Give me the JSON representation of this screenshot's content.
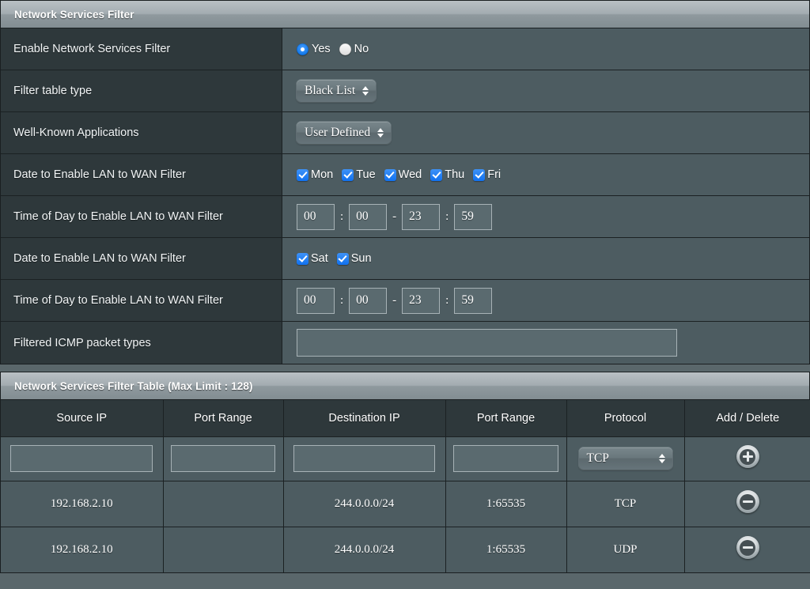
{
  "filter_panel": {
    "title": "Network Services Filter",
    "rows": {
      "enable": {
        "label": "Enable Network Services Filter",
        "options": [
          {
            "label": "Yes",
            "checked": true
          },
          {
            "label": "No",
            "checked": false
          }
        ]
      },
      "filter_table_type": {
        "label": "Filter table type",
        "value": "Black List"
      },
      "well_known_apps": {
        "label": "Well-Known Applications",
        "value": "User Defined"
      },
      "date_weekday": {
        "label": "Date to Enable LAN to WAN Filter",
        "days": [
          {
            "label": "Mon",
            "checked": true
          },
          {
            "label": "Tue",
            "checked": true
          },
          {
            "label": "Wed",
            "checked": true
          },
          {
            "label": "Thu",
            "checked": true
          },
          {
            "label": "Fri",
            "checked": true
          }
        ]
      },
      "time_weekday": {
        "label": "Time of Day to Enable LAN to WAN Filter",
        "start_hour": "00",
        "start_min": "00",
        "end_hour": "23",
        "end_min": "59",
        "colon": ":",
        "dash": "-"
      },
      "date_weekend": {
        "label": "Date to Enable LAN to WAN Filter",
        "days": [
          {
            "label": "Sat",
            "checked": true
          },
          {
            "label": "Sun",
            "checked": true
          }
        ]
      },
      "time_weekend": {
        "label": "Time of Day to Enable LAN to WAN Filter",
        "start_hour": "00",
        "start_min": "00",
        "end_hour": "23",
        "end_min": "59",
        "colon": ":",
        "dash": "-"
      },
      "icmp": {
        "label": "Filtered ICMP packet types",
        "value": "",
        "placeholder": ""
      }
    }
  },
  "filter_table": {
    "title": "Network Services Filter Table (Max Limit : 128)",
    "columns": [
      "Source IP",
      "Port Range",
      "Destination IP",
      "Port Range",
      "Protocol",
      "Add / Delete"
    ],
    "entry_row": {
      "source_ip": "",
      "source_port": "",
      "dest_ip": "",
      "dest_port": "",
      "protocol": "TCP",
      "add_icon": "plus-circle-icon"
    },
    "rows": [
      {
        "source_ip": "192.168.2.10",
        "source_port": "",
        "dest_ip": "244.0.0.0/24",
        "dest_port": "1:65535",
        "protocol": "TCP",
        "delete_icon": "minus-circle-icon"
      },
      {
        "source_ip": "192.168.2.10",
        "source_port": "",
        "dest_ip": "244.0.0.0/24",
        "dest_port": "1:65535",
        "protocol": "UDP",
        "delete_icon": "minus-circle-icon"
      }
    ]
  },
  "colors": {
    "label_bg": "#2e383b",
    "value_bg": "#4d5c61",
    "header_bg": "#a3acb1",
    "accent_blue": "#1071ef",
    "page_bg": "#5a676b"
  }
}
